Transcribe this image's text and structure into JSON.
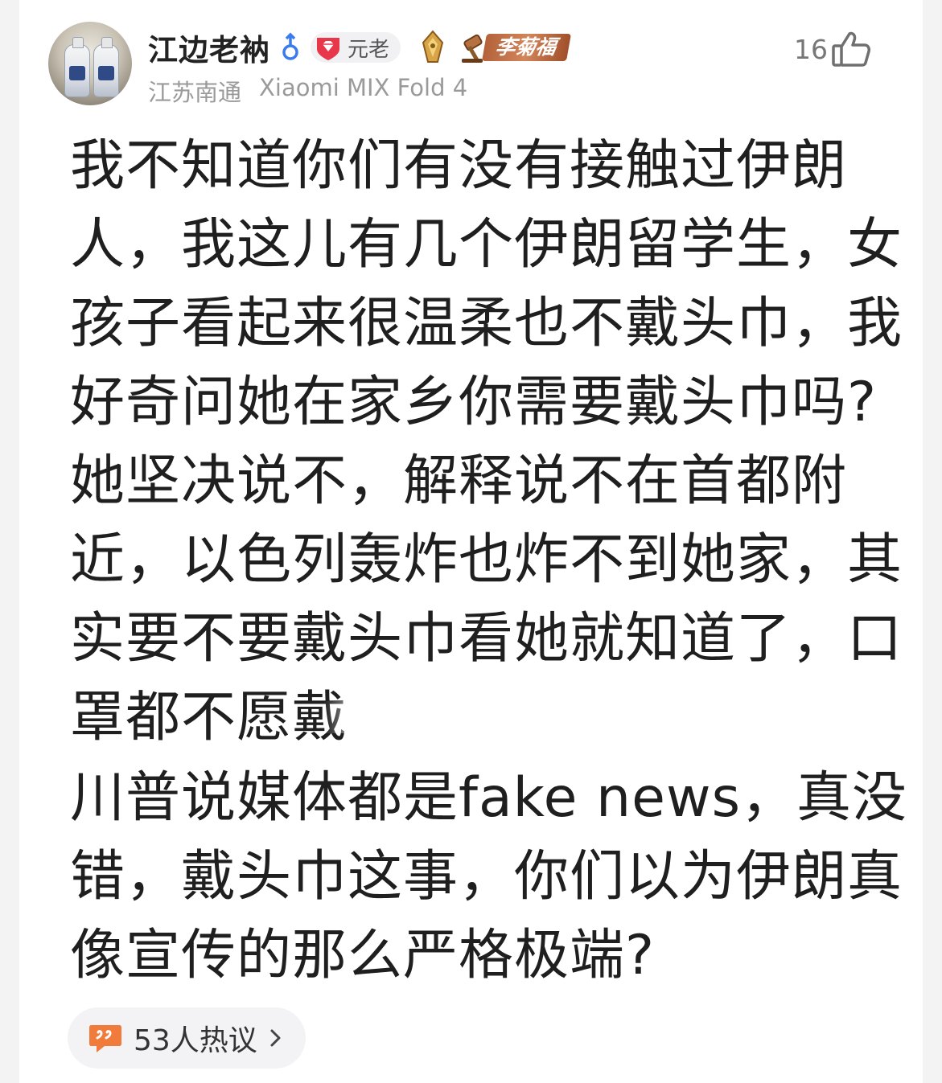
{
  "post": {
    "author": {
      "name": "江边老衲",
      "gender_icon": "male-icon",
      "level_label": "元老",
      "fan_badge_label": "李菊福",
      "location": "江苏南通",
      "device": "Xiaomi MIX Fold 4"
    },
    "likes": {
      "count": "16"
    },
    "paragraphs": [
      "我不知道你们有没有接触过伊朗人，我这儿有几个伊朗留学生，女孩子看起来很温柔也不戴头巾，我好奇问她在家乡你需要戴头巾吗?她坚决说不，解释说不在首都附近，以色列轰炸也炸不到她家，其实要不要戴头巾看她就知道了，口罩都不愿戴",
      "川普说媒体都是fake news，真没错，戴头巾这事，你们以为伊朗真像宣传的那么严格极端?"
    ],
    "discussion": {
      "label": "53人热议"
    }
  },
  "colors": {
    "text": "#1f1f1f",
    "meta": "#9a9a9a",
    "gender_blue": "#3a7bf0",
    "level_red": "#e8364a",
    "comment_orange": "#f07b3a",
    "fan_badge": "#c06a3e"
  }
}
